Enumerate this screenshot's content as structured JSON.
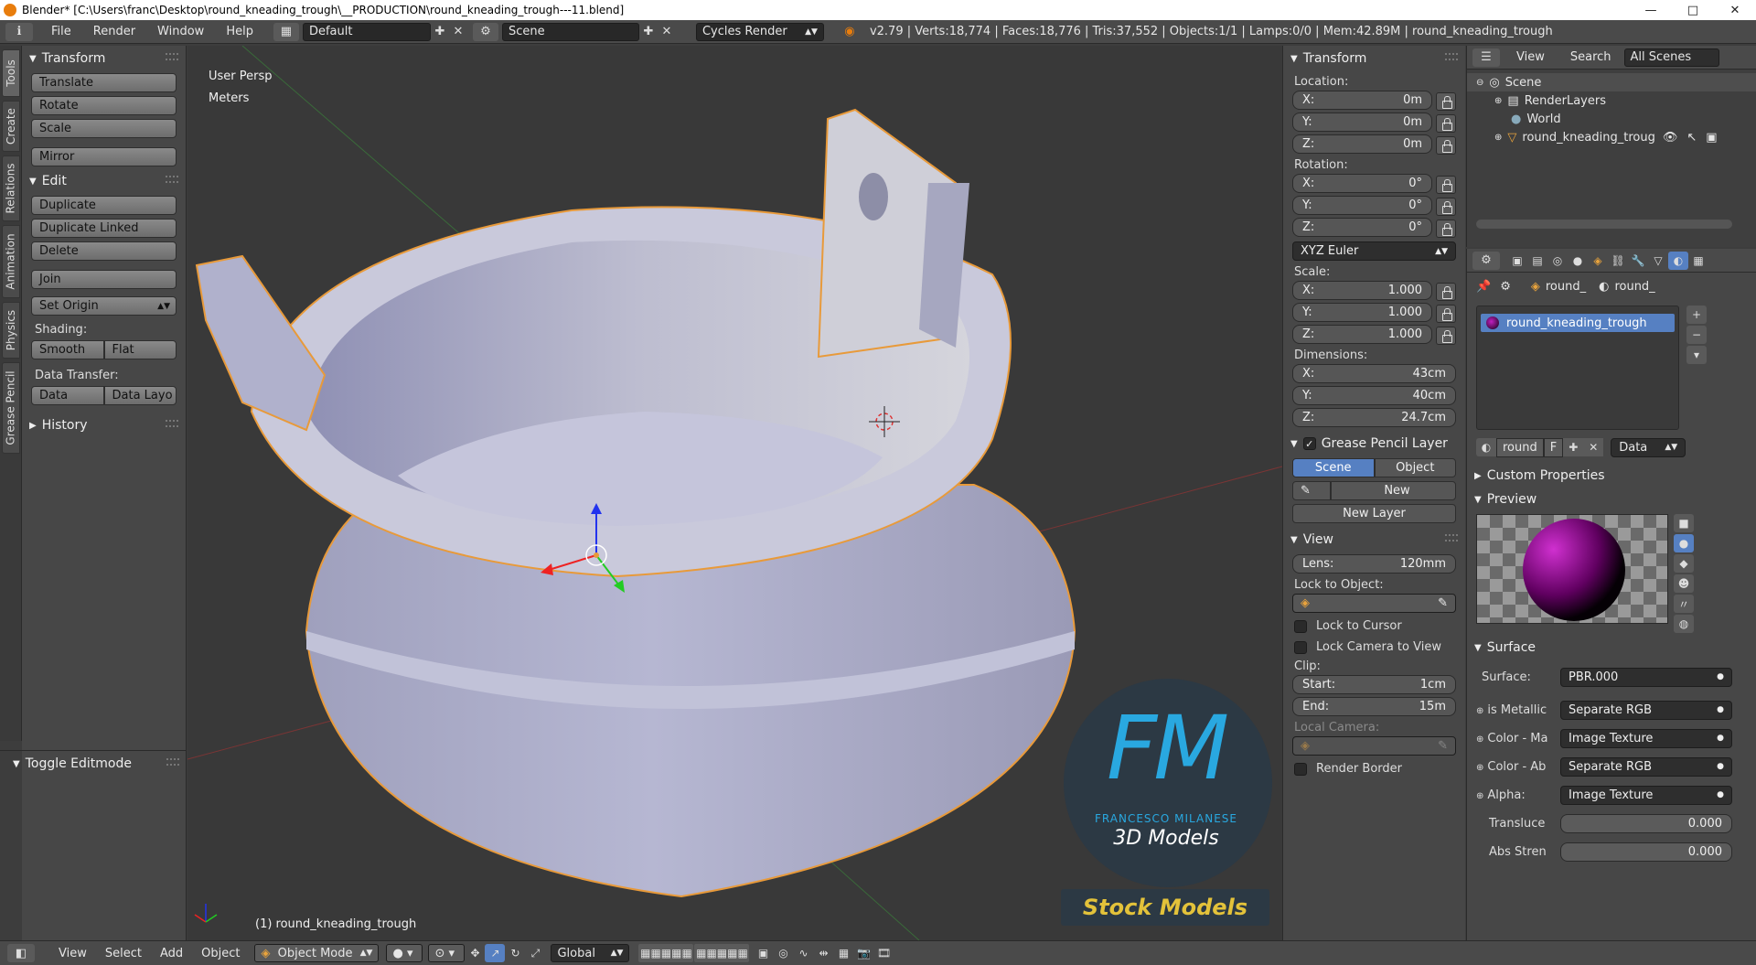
{
  "window": {
    "title": "Blender* [C:\\Users\\franc\\Desktop\\round_kneading_trough\\__PRODUCTION\\round_kneading_trough---11.blend]",
    "controls": [
      "—",
      "□",
      "✕"
    ]
  },
  "infobar": {
    "menus": [
      "File",
      "Render",
      "Window",
      "Help"
    ],
    "layout": "Default",
    "scene": "Scene",
    "engine": "Cycles Render",
    "stats": "v2.79 | Verts:18,774 | Faces:18,776 | Tris:37,552 | Objects:1/1 | Lamps:0/0 | Mem:42.89M | round_kneading_trough"
  },
  "vtabs": [
    "Tools",
    "Create",
    "Relations",
    "Animation",
    "Physics",
    "Grease Pencil"
  ],
  "toolshelf": {
    "transform": {
      "title": "Transform",
      "buttons": [
        "Translate",
        "Rotate",
        "Scale",
        "Mirror"
      ]
    },
    "edit": {
      "title": "Edit",
      "buttons": [
        "Duplicate",
        "Duplicate Linked",
        "Delete",
        "Join"
      ],
      "set_origin": "Set Origin",
      "shading_label": "Shading:",
      "smooth": "Smooth",
      "flat": "Flat",
      "data_transfer_label": "Data Transfer:",
      "data": "Data",
      "data_layout": "Data Layo"
    },
    "history": "History",
    "toggle_editmode": "Toggle Editmode"
  },
  "viewport": {
    "view_name": "User Persp",
    "units": "Meters",
    "object_label": "(1) round_kneading_trough",
    "watermark": {
      "logo": "FM",
      "author": "FRANCESCO MILANESE",
      "subtitle": "3D Models",
      "stock": "Stock Models"
    }
  },
  "npanel": {
    "transform_title": "Transform",
    "location_label": "Location:",
    "location": [
      {
        "axis": "X:",
        "value": "0m"
      },
      {
        "axis": "Y:",
        "value": "0m"
      },
      {
        "axis": "Z:",
        "value": "0m"
      }
    ],
    "rotation_label": "Rotation:",
    "rotation": [
      {
        "axis": "X:",
        "value": "0°"
      },
      {
        "axis": "Y:",
        "value": "0°"
      },
      {
        "axis": "Z:",
        "value": "0°"
      }
    ],
    "rotation_mode": "XYZ Euler",
    "scale_label": "Scale:",
    "scale": [
      {
        "axis": "X:",
        "value": "1.000"
      },
      {
        "axis": "Y:",
        "value": "1.000"
      },
      {
        "axis": "Z:",
        "value": "1.000"
      }
    ],
    "dimensions_label": "Dimensions:",
    "dimensions": [
      {
        "axis": "X:",
        "value": "43cm"
      },
      {
        "axis": "Y:",
        "value": "40cm"
      },
      {
        "axis": "Z:",
        "value": "24.7cm"
      }
    ],
    "grease_title": "Grease Pencil Layer",
    "gp_scene": "Scene",
    "gp_object": "Object",
    "gp_new": "New",
    "gp_new_layer": "New Layer",
    "view_title": "View",
    "lens_label": "Lens:",
    "lens_value": "120mm",
    "lock_object_label": "Lock to Object:",
    "lock_cursor": "Lock to Cursor",
    "lock_camera": "Lock Camera to View",
    "clip_label": "Clip:",
    "clip_start_label": "Start:",
    "clip_start": "1cm",
    "clip_end_label": "End:",
    "clip_end": "15m",
    "local_camera": "Local Camera:",
    "render_border": "Render Border"
  },
  "outliner": {
    "menus": [
      "View",
      "Search"
    ],
    "filter": "All Scenes",
    "items": [
      "Scene",
      "RenderLayers",
      "World",
      "round_kneading_troug"
    ]
  },
  "properties": {
    "breadcrumb": [
      "round_",
      "round_"
    ],
    "material_slot": "round_kneading_trough",
    "material_name": "round",
    "material_f": "F",
    "material_link": "Data",
    "custom_props": "Custom Properties",
    "preview": "Preview",
    "surface_title": "Surface",
    "surface_label": "Surface:",
    "surface_value": "PBR.000",
    "inputs": [
      {
        "label": "is Metallic",
        "value": "Separate RGB"
      },
      {
        "label": "Color - Ma",
        "value": "Image Texture"
      },
      {
        "label": "Color - Ab",
        "value": "Separate RGB"
      },
      {
        "label": "Alpha:",
        "value": "Image Texture"
      }
    ],
    "translucency_label": "Transluce",
    "translucency_value": "0.000",
    "abs_label": "Abs Stren",
    "abs_value": "0.000"
  },
  "bottombar": {
    "menus": [
      "View",
      "Select",
      "Add",
      "Object"
    ],
    "mode": "Object Mode",
    "orientation": "Global"
  }
}
